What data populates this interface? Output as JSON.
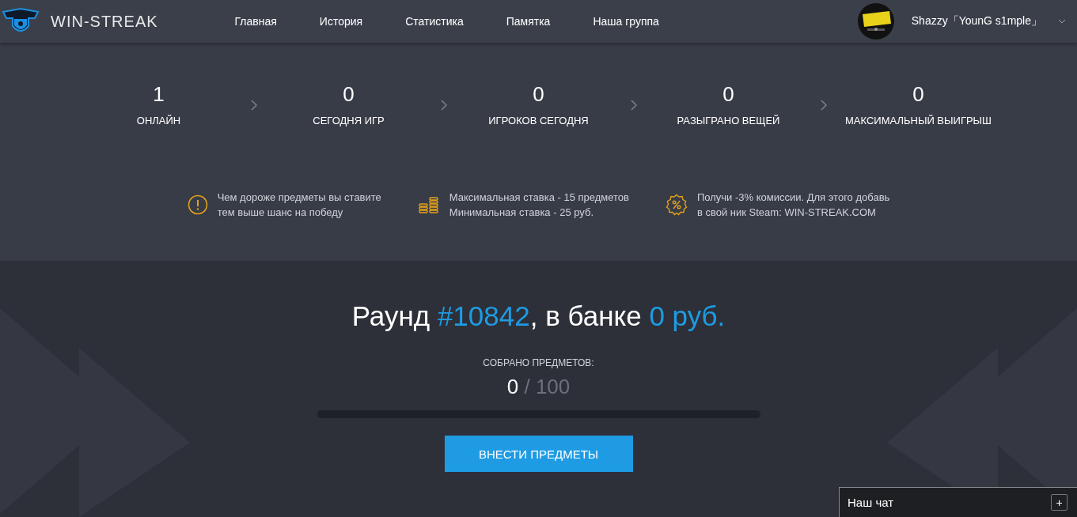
{
  "header": {
    "brand": "WIN-STREAK",
    "nav": [
      {
        "label": "Главная"
      },
      {
        "label": "История"
      },
      {
        "label": "Статистика"
      },
      {
        "label": "Памятка"
      },
      {
        "label": "Наша группа"
      }
    ],
    "user": {
      "name": "Shazzy「YounG s1mple」"
    }
  },
  "stats": [
    {
      "value": "1",
      "label": "ОНЛАЙН"
    },
    {
      "value": "0",
      "label": "СЕГОДНЯ ИГР"
    },
    {
      "value": "0",
      "label": "ИГРОКОВ СЕГОДНЯ"
    },
    {
      "value": "0",
      "label": "РАЗЫГРАНО ВЕЩЕЙ"
    },
    {
      "value": "0",
      "label": "МАКСИМАЛЬНЫЙ ВЫИГРЫШ"
    }
  ],
  "tips": [
    {
      "kind": "warning",
      "lines": [
        "Чем дороже предметы вы ставите",
        "тем выше шанс на победу"
      ]
    },
    {
      "kind": "coins",
      "lines": [
        "Максимальная ставка - 15 предметов",
        "Минимальная ставка - 25 руб."
      ]
    },
    {
      "kind": "percent",
      "lines": [
        "Получи -3% комиссии. Для этого добавь",
        "в свой ник Steam: WIN-STREAK.COM"
      ]
    }
  ],
  "round": {
    "title_parts": [
      {
        "text": "Раунд ",
        "highlight": false
      },
      {
        "text": "#10842",
        "highlight": true
      },
      {
        "text": ", в банке ",
        "highlight": false
      },
      {
        "text": "0 руб.",
        "highlight": true
      }
    ],
    "collected_label": "СОБРАНО ПРЕДМЕТОВ:",
    "collected": "0",
    "total": "/ 100",
    "level": 0,
    "button": "ВНЕСТИ ПРЕДМЕТЫ"
  },
  "chat": {
    "title": "Наш чат",
    "toggle": "+"
  }
}
